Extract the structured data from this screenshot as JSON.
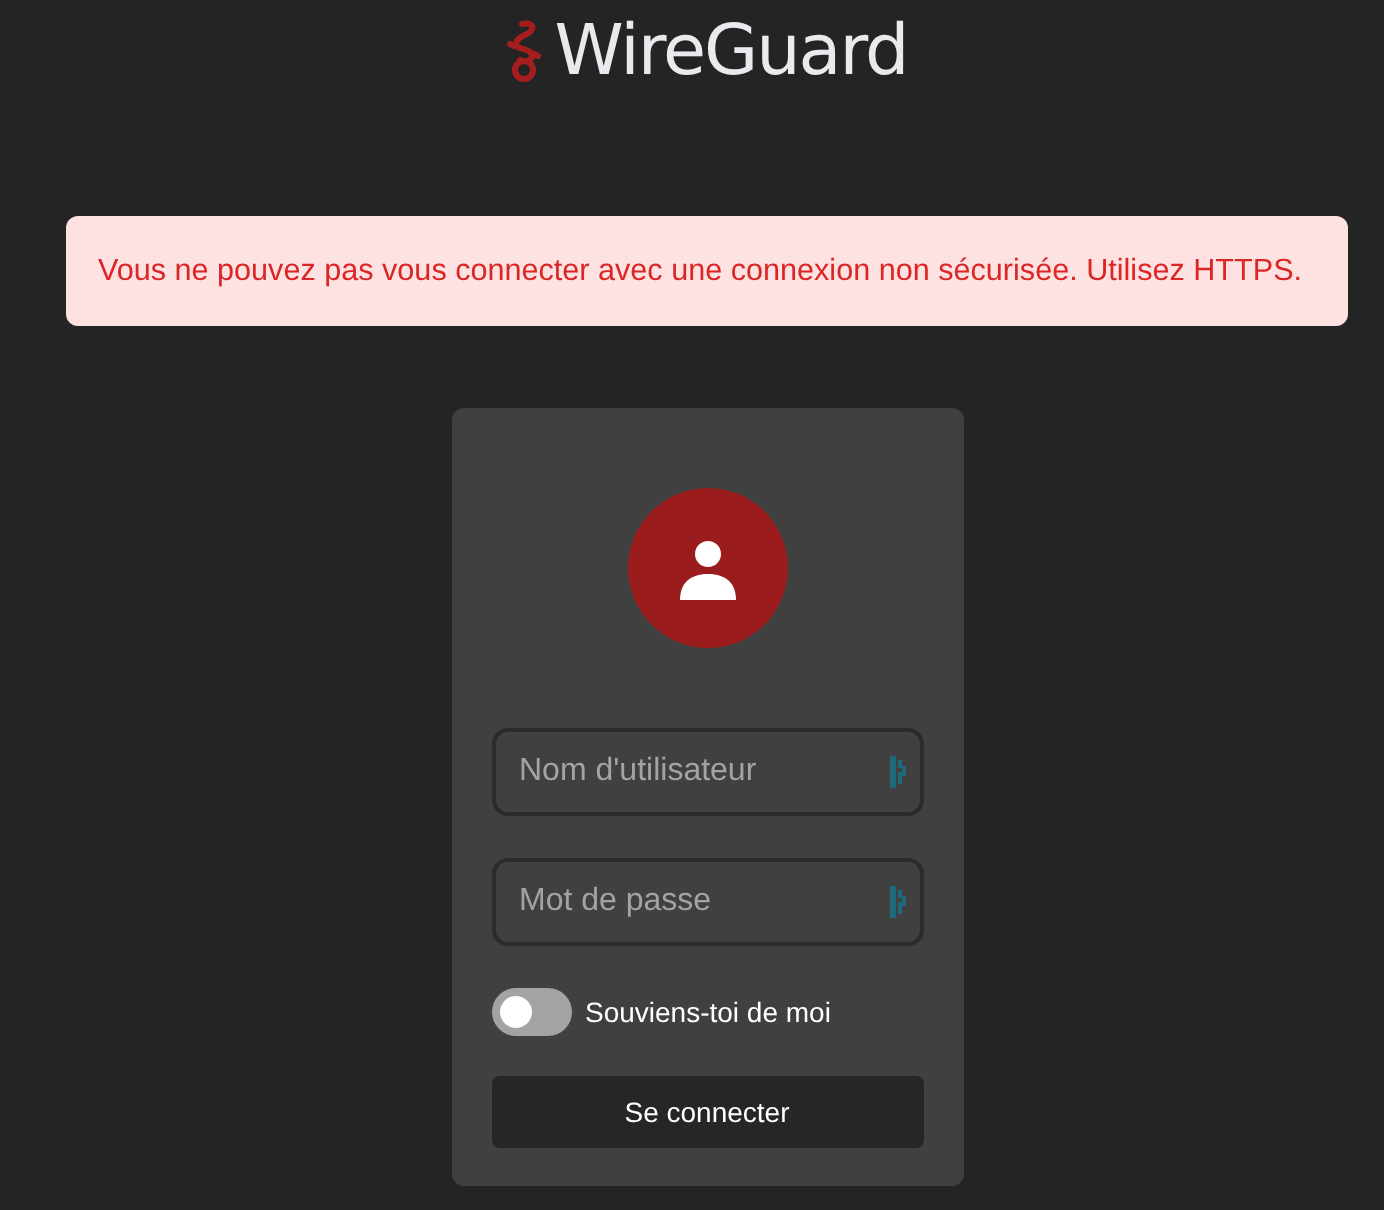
{
  "header": {
    "title": "WireGuard"
  },
  "alert": {
    "message": "Vous ne pouvez pas vous connecter avec une connexion non sécurisée. Utilisez HTTPS."
  },
  "login_form": {
    "fields": [
      {
        "placeholder": "Nom d'utilisateur"
      },
      {
        "placeholder": "Mot de passe"
      }
    ],
    "remember_me": {
      "label": "Souviens-toi de moi",
      "on": false
    },
    "submit_button": "Se connecter"
  }
}
